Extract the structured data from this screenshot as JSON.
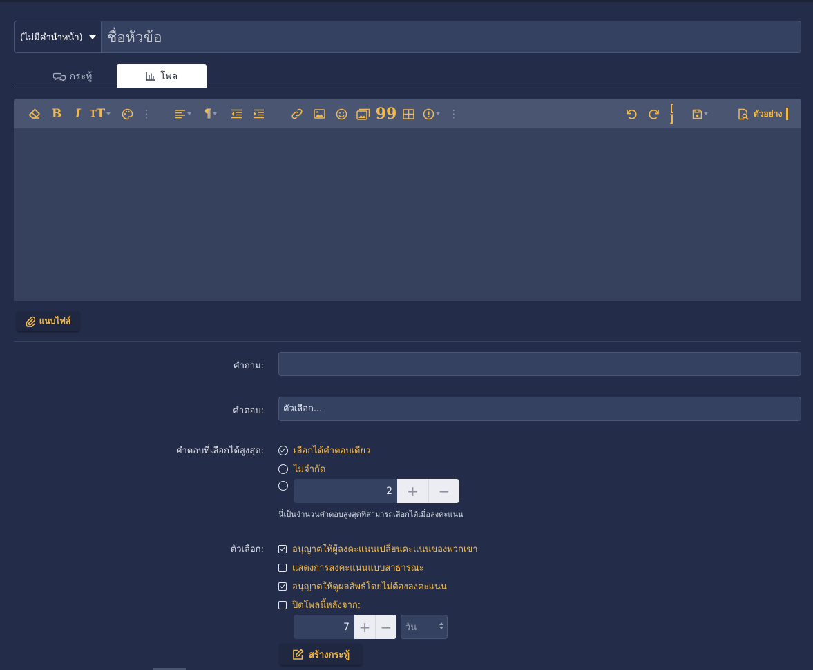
{
  "title_bar": {
    "prefix_label": "(ไม่มีคำนำหน้า)",
    "title_placeholder": "ชื่อหัวข้อ"
  },
  "tabs": [
    {
      "label": "กระทู้",
      "icon": "comments-icon",
      "active": false
    },
    {
      "label": "โพล",
      "icon": "bar-chart-icon",
      "active": true
    }
  ],
  "editor": {
    "toolbar_icons": [
      "eraser-icon",
      "bold-icon",
      "italic-icon",
      "text-size-icon",
      "palette-icon",
      "more-icon",
      "align-icon",
      "paragraph-icon",
      "outdent-icon",
      "indent-icon",
      "link-icon",
      "image-icon",
      "smiley-icon",
      "media-icon",
      "quote-icon",
      "table-icon",
      "alert-icon",
      "more-icon",
      "undo-icon",
      "redo-icon",
      "bbcode-icon",
      "save-draft-icon",
      "preview-icon"
    ],
    "preview_label": "ตัวอย่าง"
  },
  "attach": {
    "label": "แนบไฟล์"
  },
  "form": {
    "question_label": "คำถาม:",
    "question_value": "",
    "answers_label": "คำตอบ:",
    "answers_placeholder": "ตัวเลือก...",
    "max_label": "คำตอบที่เลือกได้สูงสุด:",
    "max_options": [
      {
        "label": "เลือกได้คำตอบเดียว",
        "checked": true
      },
      {
        "label": "ไม่จำกัด",
        "checked": false
      }
    ],
    "max_value": "2",
    "max_hint": "นี่เป็นจำนวนคำตอบสูงสุดที่สามารถเลือกได้เมื่อลงคะแนน",
    "options_label": "ตัวเลือก:",
    "options": [
      {
        "label": "อนุญาตให้ผู้ลงคะแนนเปลี่ยนคะแนนของพวกเขา",
        "checked": true
      },
      {
        "label": "แสดงการลงคะแนนแบบสาธารณะ",
        "checked": false
      },
      {
        "label": "อนุญาตให้ดูผลลัพธ์โดยไม่ต้องลงคะแนน",
        "checked": true
      },
      {
        "label": "ปิดโพลนี้หลังจาก:",
        "checked": false
      }
    ],
    "close_value": "7",
    "close_unit": "วัน",
    "stepper_plus": "+",
    "stepper_minus": "−"
  },
  "submit": {
    "label": "สร้างกระทู้"
  },
  "colors": {
    "accent": "#f1b94b",
    "background": "#232c48",
    "input": "#344160",
    "toolbar": "#4a5572"
  }
}
